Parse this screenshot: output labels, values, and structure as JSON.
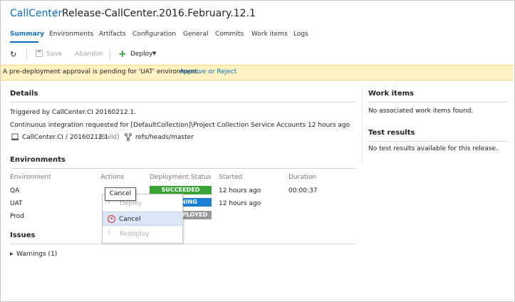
{
  "header": {
    "project": "CallCenter",
    "separator": "/",
    "release": "Release-CallCenter.2016.February.12.1"
  },
  "tabs": [
    "Summary",
    "Environments",
    "Artifacts",
    "Configuration",
    "General",
    "Commits",
    "Work items",
    "Logs"
  ],
  "toolbar": {
    "refresh_icon": "refresh-icon",
    "save_label": "Save",
    "abandon_label": "Abandon",
    "deploy_label": "Deploy"
  },
  "banner": {
    "text": "A pre-deployment approval is pending for 'UAT' environment.",
    "link": "Approve or Reject"
  },
  "details": {
    "heading": "Details",
    "triggered": "Triggered by CallCenter.CI 20160212.1.",
    "integration": "Continuous integration requested for [DefaultCollection]\\Project Collection Service Accounts 12 hours ago",
    "artifact": "CallCenter.CI / 20160212.1",
    "artifact_type": "(Build)",
    "branch": "refs/heads/master"
  },
  "environments": {
    "heading": "Environments",
    "columns": {
      "environment": "Environment",
      "actions": "Actions",
      "status": "Deployment Status",
      "started": "Started",
      "duration": "Duration"
    },
    "rows": [
      {
        "name": "QA",
        "status": "SUCCEEDED",
        "started": "12 hours ago",
        "duration": "00:00:37"
      },
      {
        "name": "UAT",
        "status": "NING",
        "started": "12 hours ago",
        "duration": ""
      },
      {
        "name": "Prod",
        "status": "PLOYED",
        "started": "",
        "duration": ""
      }
    ]
  },
  "context_menu": {
    "tooltip": "Cancel",
    "deploy": "Deploy",
    "cancel": "Cancel",
    "redeploy": "Redeploy"
  },
  "issues": {
    "heading": "Issues",
    "warnings": "Warnings (1)"
  },
  "work_items": {
    "heading": "Work items",
    "text": "No associated work items found."
  },
  "test_results": {
    "heading": "Test results",
    "text": "No test results available for this release."
  },
  "colors": {
    "accent": "#106ebe",
    "succeeded": "#3aa537",
    "in_progress": "#1a7fd1",
    "not_deployed": "#999999",
    "banner": "#fdf3c2"
  }
}
